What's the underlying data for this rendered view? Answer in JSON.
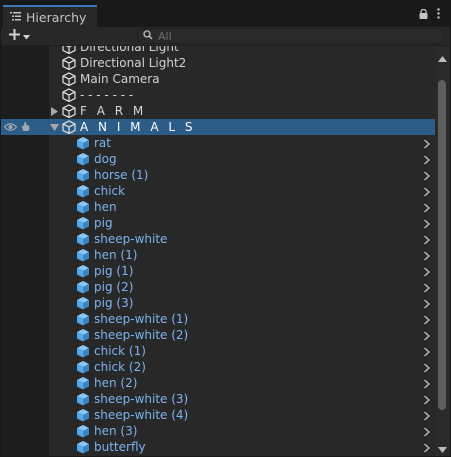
{
  "tab": {
    "title": "Hierarchy",
    "icon": "hierarchy-list-icon",
    "lock_icon": "lock-icon",
    "menu_icon": "kebab-menu-icon"
  },
  "toolbar": {
    "add_icon": "plus-icon",
    "dropdown_icon": "caret-down-icon",
    "search_icon": "search-icon",
    "search_placeholder": "All",
    "search_value": ""
  },
  "items": [
    {
      "label": "Directional Light",
      "type": "top",
      "indent": 0
    },
    {
      "label": "Directional Light2",
      "type": "top",
      "indent": 0
    },
    {
      "label": "Main Camera",
      "type": "top",
      "indent": 0
    },
    {
      "label": "- - - - - - -",
      "type": "top",
      "indent": 0
    },
    {
      "label": "F A R M",
      "type": "header",
      "indent": 0,
      "expandable": true,
      "expanded": false
    },
    {
      "label": "A N I M A L S",
      "type": "header",
      "indent": 0,
      "expandable": true,
      "expanded": true,
      "selected": true
    },
    {
      "label": "rat",
      "type": "prefab",
      "indent": 1
    },
    {
      "label": "dog",
      "type": "prefab",
      "indent": 1
    },
    {
      "label": "horse (1)",
      "type": "prefab",
      "indent": 1
    },
    {
      "label": "chick",
      "type": "prefab",
      "indent": 1
    },
    {
      "label": "hen",
      "type": "prefab",
      "indent": 1
    },
    {
      "label": "pig",
      "type": "prefab",
      "indent": 1
    },
    {
      "label": "sheep-white",
      "type": "prefab",
      "indent": 1
    },
    {
      "label": "hen (1)",
      "type": "prefab",
      "indent": 1
    },
    {
      "label": "pig (1)",
      "type": "prefab",
      "indent": 1
    },
    {
      "label": "pig (2)",
      "type": "prefab",
      "indent": 1
    },
    {
      "label": "pig (3)",
      "type": "prefab",
      "indent": 1
    },
    {
      "label": "sheep-white (1)",
      "type": "prefab",
      "indent": 1
    },
    {
      "label": "sheep-white (2)",
      "type": "prefab",
      "indent": 1
    },
    {
      "label": "chick (1)",
      "type": "prefab",
      "indent": 1
    },
    {
      "label": "chick (2)",
      "type": "prefab",
      "indent": 1
    },
    {
      "label": "hen (2)",
      "type": "prefab",
      "indent": 1
    },
    {
      "label": "sheep-white (3)",
      "type": "prefab",
      "indent": 1
    },
    {
      "label": "sheep-white (4)",
      "type": "prefab",
      "indent": 1
    },
    {
      "label": "hen (3)",
      "type": "prefab",
      "indent": 1
    },
    {
      "label": "butterfly",
      "type": "prefab",
      "indent": 1
    }
  ],
  "colors": {
    "selection": "#2c5d87",
    "prefab_text": "#7fb3f0",
    "prefab_icon": "#5aa6e6",
    "tab_accent": "#3a79bb"
  }
}
